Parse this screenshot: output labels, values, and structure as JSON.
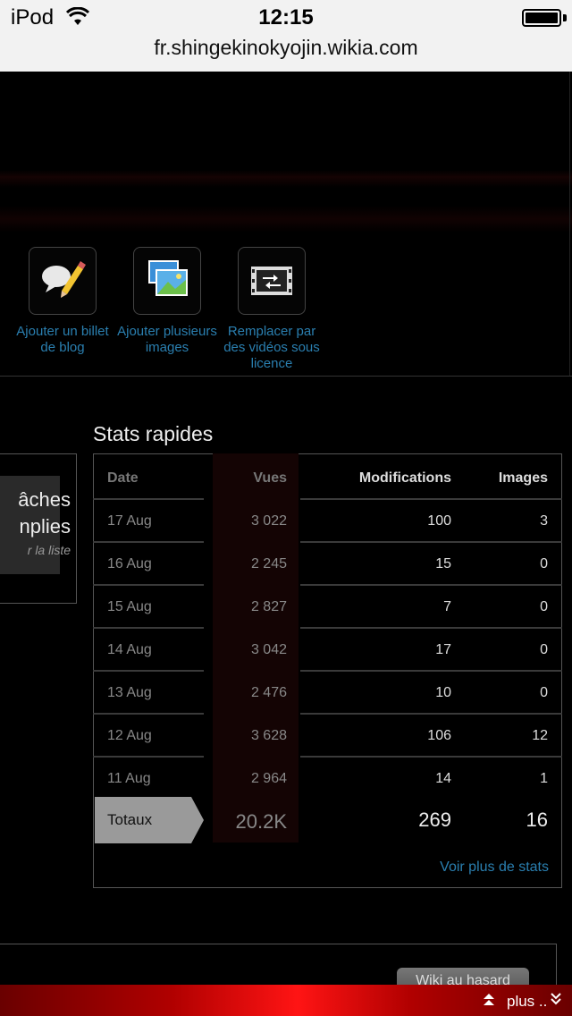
{
  "status_bar": {
    "carrier": "iPod",
    "time": "12:15"
  },
  "browser": {
    "url": "fr.shingekinokyojin.wikia.com"
  },
  "tools": [
    {
      "label": "Ajouter un billet de blog",
      "icon": "blog-pencil-icon"
    },
    {
      "label": "Ajouter plusieurs images",
      "icon": "multiple-images-icon"
    },
    {
      "label": "Remplacer par des vidéos sous licence",
      "icon": "video-swap-icon"
    }
  ],
  "left_panel": {
    "line1": "âches",
    "line2": "nplies",
    "line3": "r la liste"
  },
  "stats": {
    "title": "Stats rapides",
    "headers": {
      "date": "Date",
      "views": "Vues",
      "mods": "Modifications",
      "images": "Images"
    },
    "rows": [
      {
        "date": "17 Aug",
        "views": "3 022",
        "mods": "100",
        "images": "3"
      },
      {
        "date": "16 Aug",
        "views": "2 245",
        "mods": "15",
        "images": "0"
      },
      {
        "date": "15 Aug",
        "views": "2 827",
        "mods": "7",
        "images": "0"
      },
      {
        "date": "14 Aug",
        "views": "3 042",
        "mods": "17",
        "images": "0"
      },
      {
        "date": "13 Aug",
        "views": "2 476",
        "mods": "10",
        "images": "0"
      },
      {
        "date": "12 Aug",
        "views": "3 628",
        "mods": "106",
        "images": "12"
      },
      {
        "date": "11 Aug",
        "views": "2 964",
        "mods": "14",
        "images": "1"
      }
    ],
    "totals": {
      "label": "Totaux",
      "views": "20.2K",
      "mods": "269",
      "images": "16"
    },
    "more_link": "Voir plus de stats"
  },
  "bottom": {
    "random_button": "Wiki au hasard",
    "more_label": "plus .."
  },
  "colors": {
    "link": "#2a7fb0",
    "totals_bg": "#9a9a9a",
    "bar_red": "#ff1414"
  }
}
